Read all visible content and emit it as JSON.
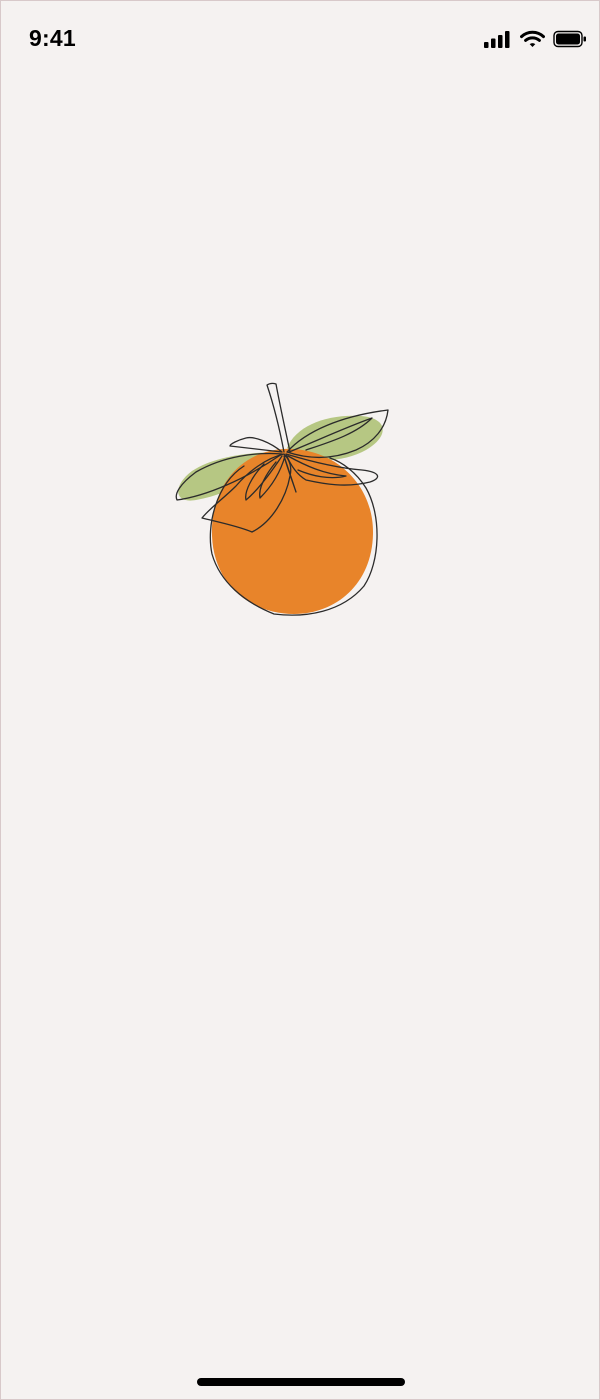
{
  "status_bar": {
    "time": "9:41",
    "icons": [
      "signal-icon",
      "wifi-icon",
      "battery-icon"
    ]
  },
  "illustration": {
    "subject": "orange-with-leaves",
    "colors": {
      "fruit": "#e8842a",
      "leaf": "#b6c783",
      "outline": "#2b2b2b"
    }
  },
  "colors": {
    "background": "#f5f2f1",
    "text": "#000000"
  }
}
